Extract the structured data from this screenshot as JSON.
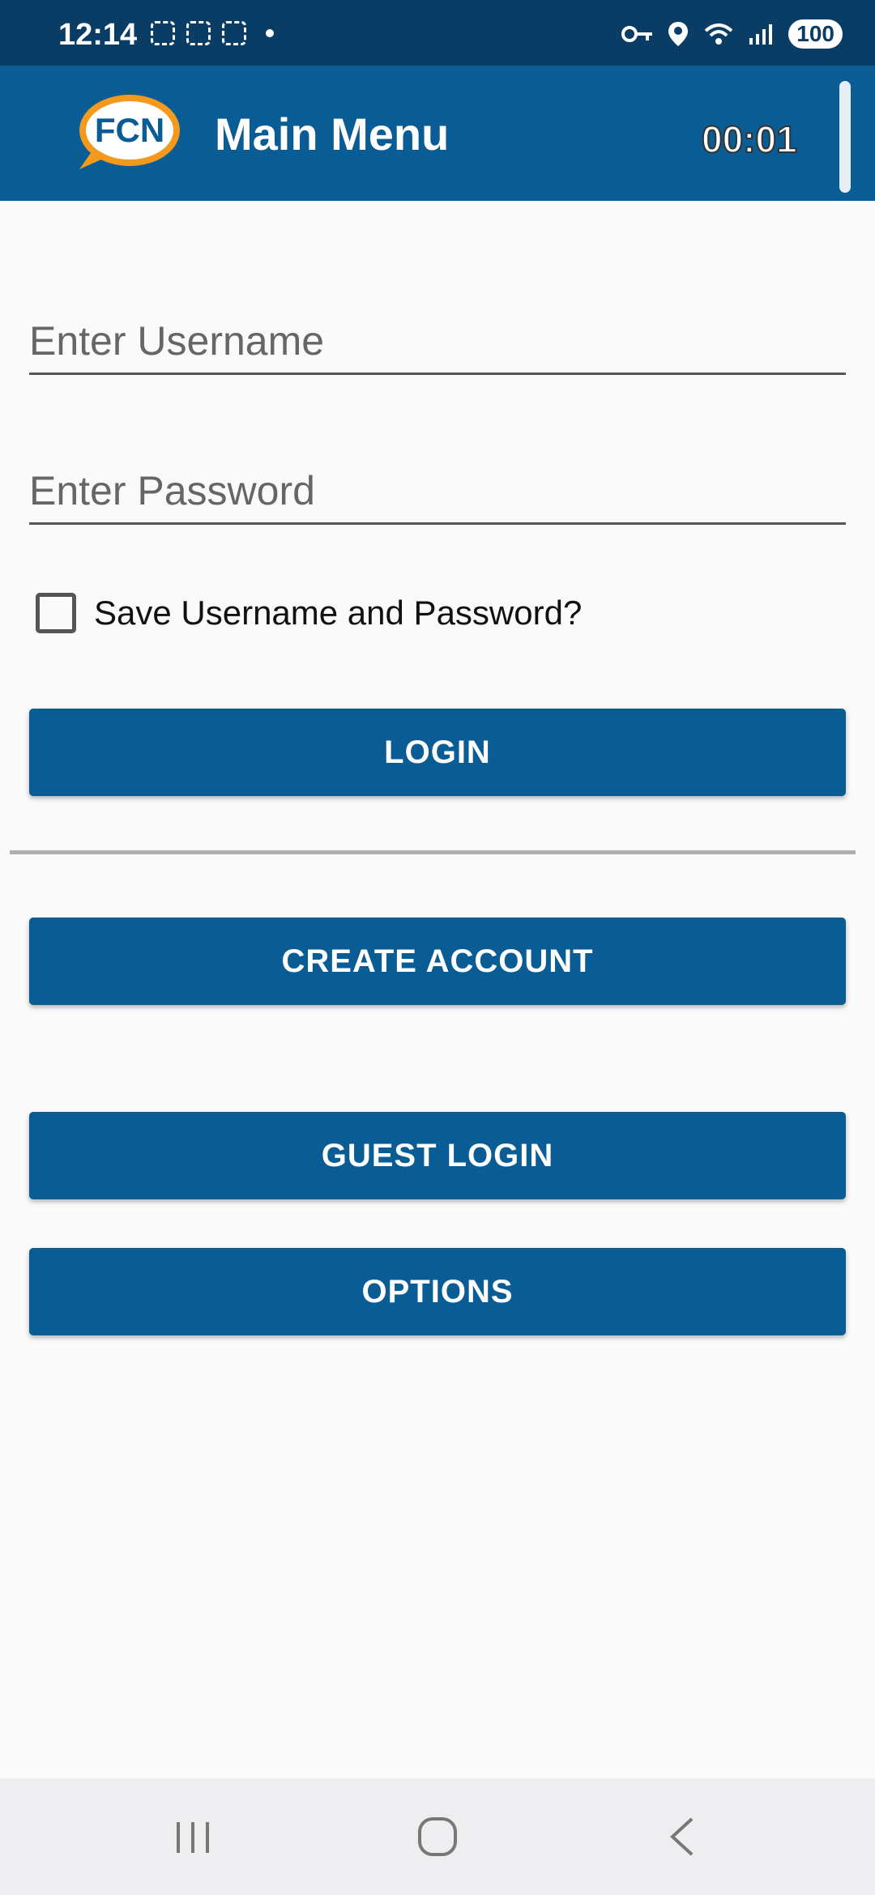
{
  "status_bar": {
    "time": "12:14",
    "left_icons": [
      "screenshot-icon",
      "screen-record-icon",
      "gallery-icon",
      "notification-dot-icon"
    ],
    "right_icons": [
      "vpn-key-icon",
      "location-icon",
      "wifi-icon",
      "signal-icon"
    ],
    "battery": "100"
  },
  "app_bar": {
    "logo_text": "FCN",
    "title": "Main Menu",
    "timer": "00:01"
  },
  "form": {
    "username_placeholder": "Enter Username",
    "username_value": "",
    "password_placeholder": "Enter Password",
    "password_value": "",
    "save_label": "Save Username and Password?",
    "save_checked": false
  },
  "buttons": {
    "login": "LOGIN",
    "create_account": "CREATE ACCOUNT",
    "guest_login": "GUEST LOGIN",
    "options": "OPTIONS"
  },
  "nav_bar": {
    "items": [
      "recent-apps-icon",
      "home-icon",
      "back-icon"
    ]
  },
  "colors": {
    "primary": "#0a5d94",
    "status_bar": "#0a3d66",
    "logo_orange": "#f39a1e",
    "background": "#fafafa"
  }
}
